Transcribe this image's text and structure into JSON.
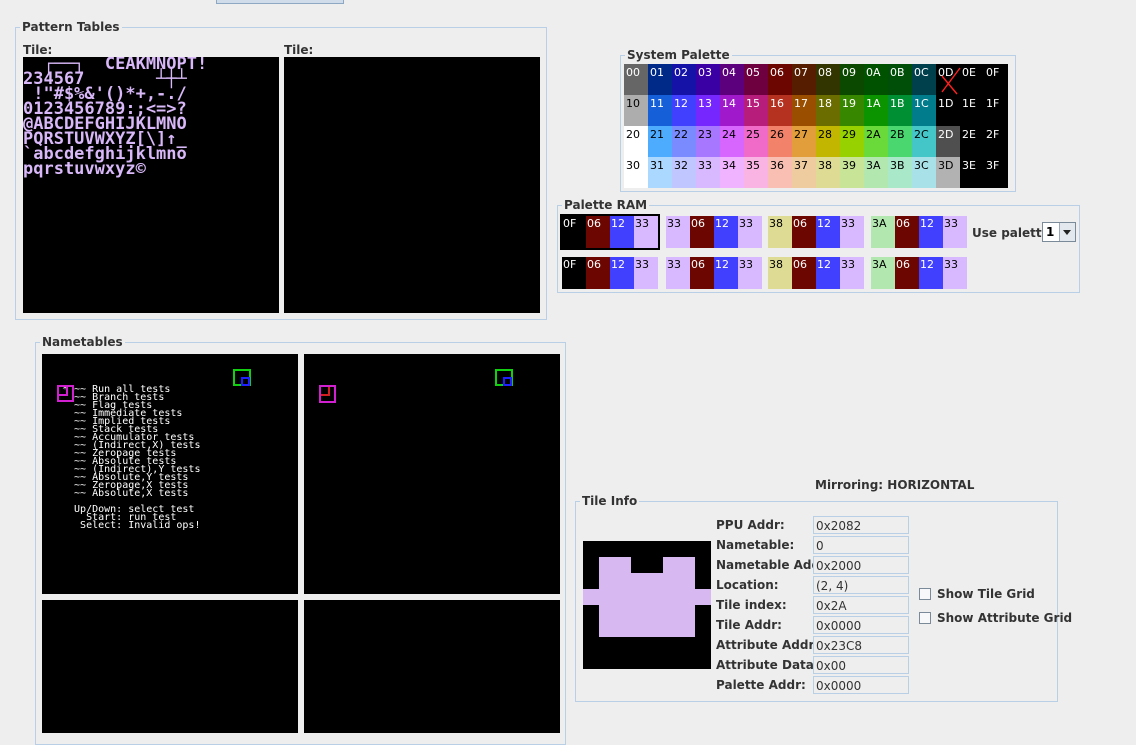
{
  "pattern_tables": {
    "legend": "Pattern Tables",
    "tile_label_left": "Tile:",
    "tile_label_right": "Tile:",
    "glyph_rows": [
      "  ┌──┐  CEAKMNOPT!",
      "234567       ┴┼┴",
      " !\"#$%&'()*+,-./",
      "0123456789:;<=>?",
      "@ABCDEFGHIJKLMNO",
      "PQRSTUVWXYZ[\\]↑_",
      "`abcdefghijklmno",
      "pqrstuvwxyz©"
    ]
  },
  "system_palette": {
    "legend": "System Palette",
    "cells": [
      {
        "code": "00",
        "bg": "#666666",
        "fg": "#ffffff"
      },
      {
        "code": "01",
        "bg": "#002a88",
        "fg": "#ffffff"
      },
      {
        "code": "02",
        "bg": "#1412a7",
        "fg": "#ffffff"
      },
      {
        "code": "03",
        "bg": "#3b00a4",
        "fg": "#ffffff"
      },
      {
        "code": "04",
        "bg": "#5c007e",
        "fg": "#ffffff"
      },
      {
        "code": "05",
        "bg": "#6e0040",
        "fg": "#ffffff"
      },
      {
        "code": "06",
        "bg": "#6c0600",
        "fg": "#ffffff"
      },
      {
        "code": "07",
        "bg": "#561d00",
        "fg": "#ffffff"
      },
      {
        "code": "08",
        "bg": "#333500",
        "fg": "#ffffff"
      },
      {
        "code": "09",
        "bg": "#0b4800",
        "fg": "#ffffff"
      },
      {
        "code": "0A",
        "bg": "#005200",
        "fg": "#ffffff"
      },
      {
        "code": "0B",
        "bg": "#004f08",
        "fg": "#ffffff"
      },
      {
        "code": "0C",
        "bg": "#00404d",
        "fg": "#ffffff"
      },
      {
        "code": "0D",
        "bg": "#000000",
        "fg": "#ffffff"
      },
      {
        "code": "0E",
        "bg": "#000000",
        "fg": "#ffffff"
      },
      {
        "code": "0F",
        "bg": "#000000",
        "fg": "#ffffff"
      },
      {
        "code": "10",
        "bg": "#adadad",
        "fg": "#000000"
      },
      {
        "code": "11",
        "bg": "#155fd9",
        "fg": "#ffffff"
      },
      {
        "code": "12",
        "bg": "#4240ff",
        "fg": "#ffffff"
      },
      {
        "code": "13",
        "bg": "#7527fe",
        "fg": "#ffffff"
      },
      {
        "code": "14",
        "bg": "#a01acc",
        "fg": "#ffffff"
      },
      {
        "code": "15",
        "bg": "#b71e7b",
        "fg": "#ffffff"
      },
      {
        "code": "16",
        "bg": "#b53120",
        "fg": "#ffffff"
      },
      {
        "code": "17",
        "bg": "#994e00",
        "fg": "#ffffff"
      },
      {
        "code": "18",
        "bg": "#6b6d00",
        "fg": "#ffffff"
      },
      {
        "code": "19",
        "bg": "#388700",
        "fg": "#ffffff"
      },
      {
        "code": "1A",
        "bg": "#0c9300",
        "fg": "#ffffff"
      },
      {
        "code": "1B",
        "bg": "#008f32",
        "fg": "#ffffff"
      },
      {
        "code": "1C",
        "bg": "#007c8d",
        "fg": "#ffffff"
      },
      {
        "code": "1D",
        "bg": "#000000",
        "fg": "#ffffff"
      },
      {
        "code": "1E",
        "bg": "#000000",
        "fg": "#ffffff"
      },
      {
        "code": "1F",
        "bg": "#000000",
        "fg": "#ffffff"
      },
      {
        "code": "20",
        "bg": "#ffffff",
        "fg": "#000000"
      },
      {
        "code": "21",
        "bg": "#4eacff",
        "fg": "#000000"
      },
      {
        "code": "22",
        "bg": "#7a8bff",
        "fg": "#000000"
      },
      {
        "code": "23",
        "bg": "#a877ff",
        "fg": "#000000"
      },
      {
        "code": "24",
        "bg": "#d766ff",
        "fg": "#000000"
      },
      {
        "code": "25",
        "bg": "#f06ac8",
        "fg": "#000000"
      },
      {
        "code": "26",
        "bg": "#f2826a",
        "fg": "#000000"
      },
      {
        "code": "27",
        "bg": "#e19e3a",
        "fg": "#000000"
      },
      {
        "code": "28",
        "bg": "#c2b600",
        "fg": "#000000"
      },
      {
        "code": "29",
        "bg": "#97d100",
        "fg": "#000000"
      },
      {
        "code": "2A",
        "bg": "#6ad93a",
        "fg": "#000000"
      },
      {
        "code": "2B",
        "bg": "#4ad770",
        "fg": "#000000"
      },
      {
        "code": "2C",
        "bg": "#44c6c8",
        "fg": "#000000"
      },
      {
        "code": "2D",
        "bg": "#4f4f4f",
        "fg": "#ffffff"
      },
      {
        "code": "2E",
        "bg": "#000000",
        "fg": "#ffffff"
      },
      {
        "code": "2F",
        "bg": "#000000",
        "fg": "#ffffff"
      },
      {
        "code": "30",
        "bg": "#ffffff",
        "fg": "#000000"
      },
      {
        "code": "31",
        "bg": "#abd8ff",
        "fg": "#000000"
      },
      {
        "code": "32",
        "bg": "#c0c6ff",
        "fg": "#000000"
      },
      {
        "code": "33",
        "bg": "#d8b9ff",
        "fg": "#000000"
      },
      {
        "code": "34",
        "bg": "#f0b3ff",
        "fg": "#000000"
      },
      {
        "code": "35",
        "bg": "#f9b4e4",
        "fg": "#000000"
      },
      {
        "code": "36",
        "bg": "#f9bfb3",
        "fg": "#000000"
      },
      {
        "code": "37",
        "bg": "#efcca0",
        "fg": "#000000"
      },
      {
        "code": "38",
        "bg": "#dddb94",
        "fg": "#000000"
      },
      {
        "code": "39",
        "bg": "#c7e497",
        "fg": "#000000"
      },
      {
        "code": "3A",
        "bg": "#b2e8b0",
        "fg": "#000000"
      },
      {
        "code": "3B",
        "bg": "#a9e8c8",
        "fg": "#000000"
      },
      {
        "code": "3C",
        "bg": "#a8e1e8",
        "fg": "#000000"
      },
      {
        "code": "3D",
        "bg": "#b2b2b2",
        "fg": "#000000"
      },
      {
        "code": "3E",
        "bg": "#000000",
        "fg": "#ffffff"
      },
      {
        "code": "3F",
        "bg": "#000000",
        "fg": "#ffffff"
      }
    ]
  },
  "palette_ram": {
    "legend": "Palette RAM",
    "use_palette_label": "Use palette:",
    "use_palette_value": "1",
    "rows": [
      [
        [
          {
            "code": "0F",
            "bg": "#000000"
          },
          {
            "code": "06",
            "bg": "#6c0600"
          },
          {
            "code": "12",
            "bg": "#4240ff"
          },
          {
            "code": "33",
            "bg": "#d8b9ff"
          }
        ],
        [
          {
            "code": "33",
            "bg": "#d8b9ff"
          },
          {
            "code": "06",
            "bg": "#6c0600"
          },
          {
            "code": "12",
            "bg": "#4240ff"
          },
          {
            "code": "33",
            "bg": "#d8b9ff"
          }
        ],
        [
          {
            "code": "38",
            "bg": "#dddb94"
          },
          {
            "code": "06",
            "bg": "#6c0600"
          },
          {
            "code": "12",
            "bg": "#4240ff"
          },
          {
            "code": "33",
            "bg": "#d8b9ff"
          }
        ],
        [
          {
            "code": "3A",
            "bg": "#b2e8b0"
          },
          {
            "code": "06",
            "bg": "#6c0600"
          },
          {
            "code": "12",
            "bg": "#4240ff"
          },
          {
            "code": "33",
            "bg": "#d8b9ff"
          }
        ]
      ],
      [
        [
          {
            "code": "0F",
            "bg": "#000000"
          },
          {
            "code": "06",
            "bg": "#6c0600"
          },
          {
            "code": "12",
            "bg": "#4240ff"
          },
          {
            "code": "33",
            "bg": "#d8b9ff"
          }
        ],
        [
          {
            "code": "33",
            "bg": "#d8b9ff"
          },
          {
            "code": "06",
            "bg": "#6c0600"
          },
          {
            "code": "12",
            "bg": "#4240ff"
          },
          {
            "code": "33",
            "bg": "#d8b9ff"
          }
        ],
        [
          {
            "code": "38",
            "bg": "#dddb94"
          },
          {
            "code": "06",
            "bg": "#6c0600"
          },
          {
            "code": "12",
            "bg": "#4240ff"
          },
          {
            "code": "33",
            "bg": "#d8b9ff"
          }
        ],
        [
          {
            "code": "3A",
            "bg": "#b2e8b0"
          },
          {
            "code": "06",
            "bg": "#6c0600"
          },
          {
            "code": "12",
            "bg": "#4240ff"
          },
          {
            "code": "33",
            "bg": "#d8b9ff"
          }
        ]
      ]
    ]
  },
  "nametables": {
    "legend": "Nametables",
    "screen_lines": [
      "* ~~ Run all tests",
      "  ~~ Branch tests",
      "  ~~ Flag tests",
      "  ~~ Immediate tests",
      "  ~~ Implied tests",
      "  ~~ Stack tests",
      "  ~~ Accumulator tests",
      "  ~~ (Indirect,X) tests",
      "  ~~ Zeropage tests",
      "  ~~ Absolute tests",
      "  ~~ (Indirect),Y tests",
      "  ~~ Absolute,Y tests",
      "  ~~ Zeropage,X tests",
      "  ~~ Absolute,X tests",
      "",
      "  Up/Down: select test",
      "    Start: run test",
      "   Select: Invalid ops!"
    ]
  },
  "mirroring": {
    "label": "Mirroring: HORIZONTAL"
  },
  "tile_info": {
    "legend": "Tile Info",
    "fields": [
      {
        "label": "PPU Addr:",
        "value": "0x2082"
      },
      {
        "label": "Nametable:",
        "value": "0"
      },
      {
        "label": "Nametable Addr:",
        "value": "0x2000"
      },
      {
        "label": "Location:",
        "value": "(2, 4)"
      },
      {
        "label": "Tile index:",
        "value": "0x2A"
      },
      {
        "label": "Tile Addr:",
        "value": "0x0000"
      },
      {
        "label": "Attribute Addr:",
        "value": "0x23C8"
      },
      {
        "label": "Attribute Data:",
        "value": "0x00"
      },
      {
        "label": "Palette Addr:",
        "value": "0x0000"
      }
    ],
    "show_tile_grid": "Show Tile Grid",
    "show_attribute_grid": "Show Attribute Grid"
  }
}
